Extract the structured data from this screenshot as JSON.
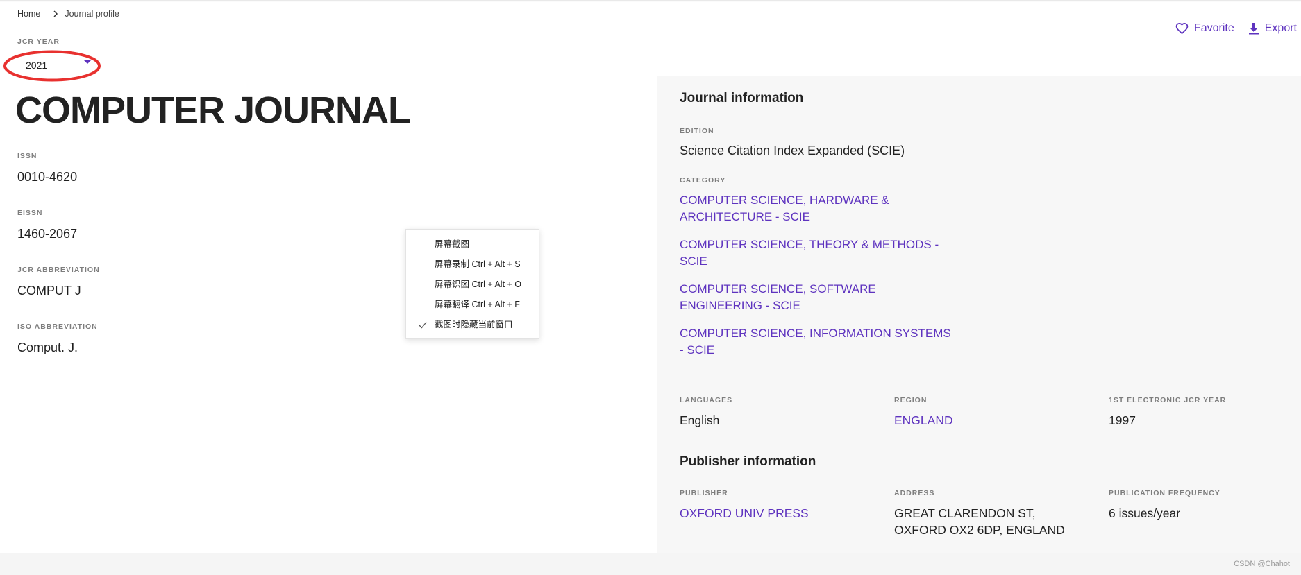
{
  "breadcrumb": {
    "home": "Home",
    "current": "Journal profile",
    "separator_icon": "chevron-right-icon"
  },
  "actions": {
    "favorite": "Favorite",
    "favorite_icon": "heart-icon",
    "export": "Export",
    "export_icon": "download-icon"
  },
  "jcr_year": {
    "label": "JCR YEAR",
    "value": "2021",
    "dropdown_icon": "caret-down-icon"
  },
  "journal": {
    "title": "COMPUTER JOURNAL",
    "fields": [
      {
        "label": "ISSN",
        "value": "0010-4620"
      },
      {
        "label": "EISSN",
        "value": "1460-2067"
      },
      {
        "label": "JCR ABBREVIATION",
        "value": "COMPUT J"
      },
      {
        "label": "ISO ABBREVIATION",
        "value": "Comput. J."
      }
    ]
  },
  "journal_information": {
    "heading": "Journal information",
    "edition": {
      "label": "EDITION",
      "value": "Science Citation Index Expanded (SCIE)"
    },
    "category": {
      "label": "CATEGORY",
      "items": [
        "COMPUTER SCIENCE, HARDWARE & ARCHITECTURE - SCIE",
        "COMPUTER SCIENCE, THEORY & METHODS - SCIE",
        "COMPUTER SCIENCE, SOFTWARE ENGINEERING - SCIE",
        "COMPUTER SCIENCE, INFORMATION SYSTEMS - SCIE"
      ]
    },
    "languages": {
      "label": "LANGUAGES",
      "value": "English"
    },
    "region": {
      "label": "REGION",
      "value": "ENGLAND"
    },
    "first_electronic_jcr_year": {
      "label": "1ST ELECTRONIC JCR YEAR",
      "value": "1997"
    }
  },
  "publisher_information": {
    "heading": "Publisher information",
    "publisher": {
      "label": "PUBLISHER",
      "value": "OXFORD UNIV PRESS"
    },
    "address": {
      "label": "ADDRESS",
      "lines": [
        "GREAT CLARENDON ST,",
        "OXFORD OX2 6DP, ENGLAND"
      ]
    },
    "publication_frequency": {
      "label": "PUBLICATION FREQUENCY",
      "value": "6 issues/year"
    }
  },
  "context_menu": {
    "items": [
      {
        "label": "屏幕截图",
        "checked": false
      },
      {
        "label": "屏幕录制 Ctrl + Alt + S",
        "checked": false
      },
      {
        "label": "屏幕识图 Ctrl + Alt + O",
        "checked": false
      },
      {
        "label": "屏幕翻译 Ctrl + Alt + F",
        "checked": false
      },
      {
        "label": "截图时隐藏当前窗口",
        "checked": true
      }
    ],
    "check_icon": "check-icon"
  },
  "watermark": "CSDN @Chahot",
  "colors": {
    "accent": "#5e33bf",
    "annotation": "#e8312f",
    "panel_bg": "#f7f7f7",
    "text": "#222222",
    "label": "#7d7d7d"
  }
}
